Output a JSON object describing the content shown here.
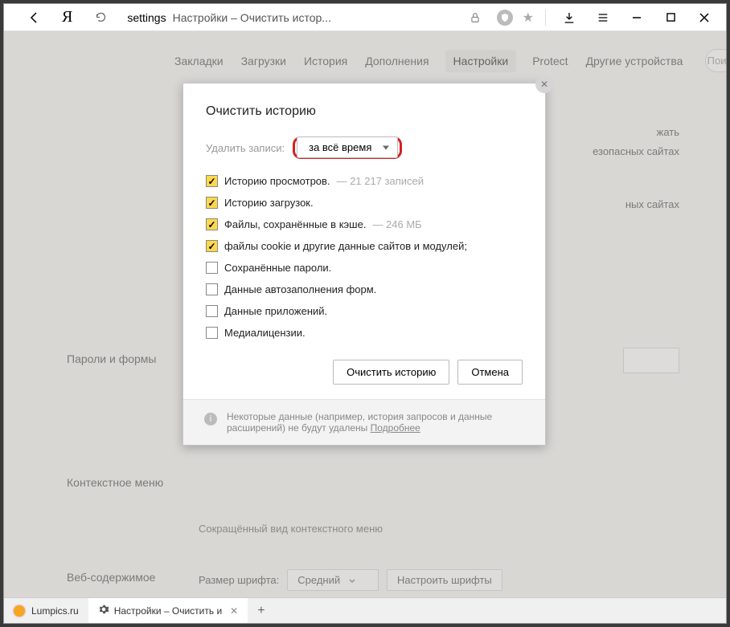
{
  "titlebar": {
    "address_prefix": "settings",
    "address_title": "Настройки – Очистить истор..."
  },
  "tabs": {
    "items": [
      "Закладки",
      "Загрузки",
      "История",
      "Дополнения",
      "Настройки",
      "Protect",
      "Другие устройства"
    ],
    "active_index": 4,
    "search_placeholder": "Поис"
  },
  "background": {
    "section_passwords": "Пароли и формы",
    "section_context": "Контекстное меню",
    "section_web": "Веб-содержимое",
    "context_sub": "Сокращённый вид контекстного меню",
    "peek1": "жать",
    "peek2": "езопасных сайтах",
    "peek3": "ных сайтах",
    "font_label": "Размер шрифта:",
    "font_value": "Средний",
    "font_btn": "Настроить шрифты"
  },
  "dialog": {
    "title": "Очистить историю",
    "delete_label": "Удалить записи:",
    "period": "за всё время",
    "items": [
      {
        "checked": true,
        "label": "Историю просмотров.",
        "hint": "—  21 217 записей"
      },
      {
        "checked": true,
        "label": "Историю загрузок.",
        "hint": ""
      },
      {
        "checked": true,
        "label": "Файлы, сохранённые в кэше.",
        "hint": "—  246 МБ"
      },
      {
        "checked": true,
        "label": "файлы cookie и другие данные сайтов и модулей;",
        "hint": ""
      },
      {
        "checked": false,
        "label": "Сохранённые пароли.",
        "hint": ""
      },
      {
        "checked": false,
        "label": "Данные автозаполнения форм.",
        "hint": ""
      },
      {
        "checked": false,
        "label": "Данные приложений.",
        "hint": ""
      },
      {
        "checked": false,
        "label": "Медиалицензии.",
        "hint": ""
      }
    ],
    "btn_clear": "Очистить историю",
    "btn_cancel": "Отмена",
    "footer_text": "Некоторые данные (например, история запросов и данные расширений) не будут удалены ",
    "footer_link": "Подробнее"
  },
  "taskbar": {
    "tab1": "Lumpics.ru",
    "tab2": "Настройки – Очистить и"
  }
}
